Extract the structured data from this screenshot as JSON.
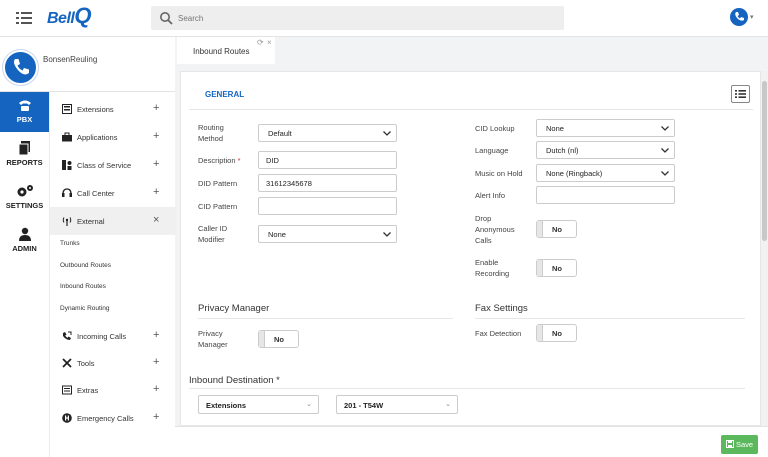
{
  "app": {
    "logo_text": "Bell",
    "logo_q": "Q"
  },
  "search": {
    "placeholder": "Search"
  },
  "user": {
    "name": "BonsenReuling"
  },
  "rail": [
    {
      "label": "PBX",
      "icon": "phone-icon"
    },
    {
      "label": "REPORTS",
      "icon": "reports-icon"
    },
    {
      "label": "SETTINGS",
      "icon": "gears-icon"
    },
    {
      "label": "ADMIN",
      "icon": "admin-icon"
    }
  ],
  "sidebar": {
    "items": [
      {
        "label": "Extensions",
        "toggle": "+"
      },
      {
        "label": "Applications",
        "toggle": "+"
      },
      {
        "label": "Class of Service",
        "toggle": "+"
      },
      {
        "label": "Call Center",
        "toggle": "+"
      },
      {
        "label": "External",
        "toggle": "×"
      },
      {
        "label": "Incoming Calls",
        "toggle": "+"
      },
      {
        "label": "Tools",
        "toggle": "+"
      },
      {
        "label": "Extras",
        "toggle": "+"
      },
      {
        "label": "Emergency Calls",
        "toggle": "+"
      }
    ],
    "sub_items": [
      "Trunks",
      "Outbound Routes",
      "Inbound Routes",
      "Dynamic Routing"
    ]
  },
  "tab": {
    "label": "Inbound Routes",
    "refresh": "⟳",
    "close": "×"
  },
  "panel": {
    "section_general": "GENERAL"
  },
  "form": {
    "routing_method": {
      "label": "Routing Method",
      "value": "Default"
    },
    "description": {
      "label": "Description",
      "required": "*",
      "value": "DID"
    },
    "did_pattern": {
      "label": "DID Pattern",
      "value": "31612345678"
    },
    "cid_pattern": {
      "label": "CID Pattern",
      "value": ""
    },
    "caller_id_modifier": {
      "label": "Caller ID Modifier",
      "value": "None"
    },
    "cid_lookup": {
      "label": "CID Lookup",
      "value": "None"
    },
    "language": {
      "label": "Language",
      "value": "Dutch (nl)"
    },
    "music_on_hold": {
      "label": "Music on Hold",
      "value": "None (Ringback)"
    },
    "alert_info": {
      "label": "Alert Info",
      "value": ""
    },
    "drop_anonymous": {
      "label": "Drop Anonymous Calls",
      "value": "No"
    },
    "enable_recording": {
      "label": "Enable Recording",
      "value": "No"
    }
  },
  "privacy": {
    "title": "Privacy Manager",
    "label": "Privacy Manager",
    "value": "No"
  },
  "fax": {
    "title": "Fax Settings",
    "label": "Fax Detection",
    "value": "No"
  },
  "destination": {
    "title": "Inbound Destination",
    "required": "*",
    "type": "Extensions",
    "target": "201 - T54W"
  },
  "footer": {
    "save_label": "Save"
  },
  "colors": {
    "accent": "#1565c0",
    "save": "#5cb85c",
    "required": "#d32f2f"
  }
}
